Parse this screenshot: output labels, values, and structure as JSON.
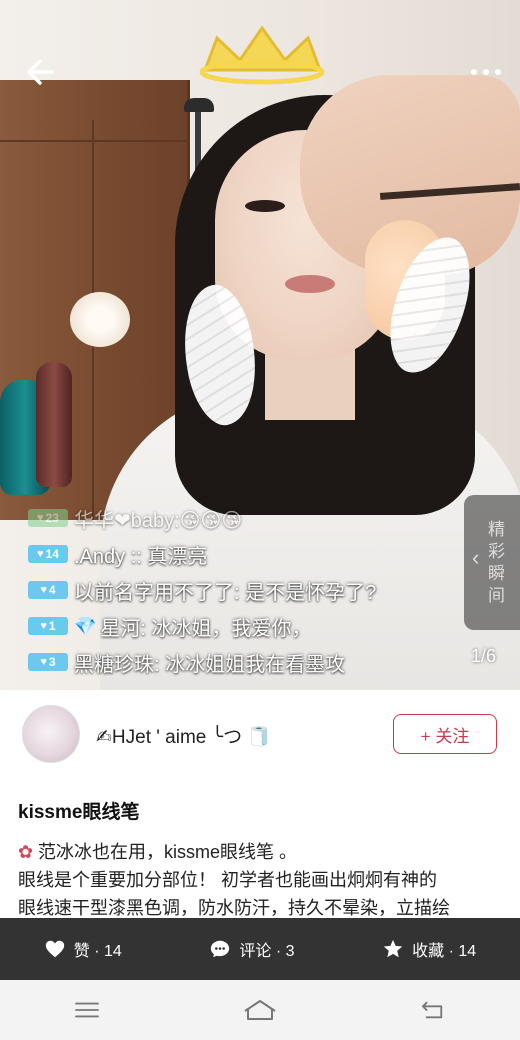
{
  "media": {
    "page_indicator": "1/6",
    "highlight_label": "精彩瞬间",
    "chat": [
      {
        "level": "23",
        "text": "华华❤baby:😘😘😘",
        "faded": true
      },
      {
        "level": "14",
        "text": ".Andy :: 真漂亮",
        "faded": false
      },
      {
        "level": "4",
        "text": "以前名字用不了了: 是不是怀孕了?",
        "faded": false
      },
      {
        "level": "1",
        "text": "星河: 冰冰姐，我爱你，",
        "faded": false
      },
      {
        "level": "3",
        "text": "黑糖珍珠: 冰冰姐姐我在看墨攻",
        "faded": false
      }
    ]
  },
  "author": {
    "name": "✍HJet ' aime ╰つ 🧻",
    "follow_label": "+ 关注"
  },
  "post": {
    "title": "kissme眼线笔",
    "line1": "范冰冰也在用，kissme眼线笔 。",
    "line2": "眼线是个重要加分部位！ 初学者也能画出炯炯有神的",
    "line3": "眼线速干型漆黑色调，防水防汗，持久不晕染，立描绘"
  },
  "actions": {
    "like": "赞 · 14",
    "comment": "评论 · 3",
    "collect": "收藏 · 14"
  },
  "colors": {
    "accent": "#c83a4e",
    "action_bar": "#333333",
    "level_badge": "#6cc9ee"
  }
}
